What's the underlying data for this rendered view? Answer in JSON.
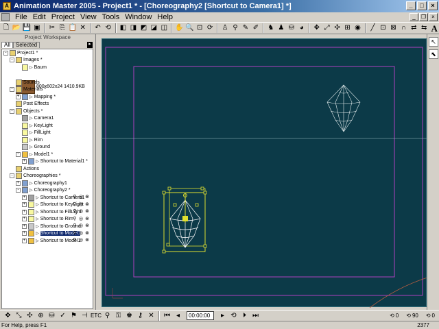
{
  "window": {
    "title": "Animation Master 2005 - Project1 * - [Choreography2 [Shortcut to Camera1] *]",
    "minimize": "_",
    "maximize": "□",
    "close": "×"
  },
  "menu": [
    "File",
    "Edit",
    "Project",
    "View",
    "Tools",
    "Window",
    "Help"
  ],
  "workspace": {
    "title": "Project Workspace",
    "tabs": [
      "All",
      "Selected"
    ],
    "tree": [
      {
        "label": "Project1 *",
        "indent": 0,
        "icon": "project-icon",
        "expand": "-"
      },
      {
        "label": "Images *",
        "indent": 1,
        "icon": "folder-icon",
        "expand": "-"
      },
      {
        "label": "Baum",
        "indent": 2,
        "icon": "image-icon",
        "expand": ""
      },
      {
        "label": "Sounds",
        "indent": 1,
        "icon": "folder-icon",
        "expand": ""
      },
      {
        "label": "Materials *",
        "indent": 1,
        "icon": "folder-icon",
        "expand": "-"
      },
      {
        "label": "Mapping *",
        "indent": 2,
        "icon": "material-icon",
        "expand": "+"
      },
      {
        "label": "Post Effects",
        "indent": 1,
        "icon": "folder-icon",
        "expand": ""
      },
      {
        "label": "Objects *",
        "indent": 1,
        "icon": "folder-icon",
        "expand": "-"
      },
      {
        "label": "Camera1",
        "indent": 2,
        "icon": "camera-icon",
        "expand": ""
      },
      {
        "label": "KeyLight",
        "indent": 2,
        "icon": "light-icon",
        "expand": ""
      },
      {
        "label": "FillLight",
        "indent": 2,
        "icon": "light-icon",
        "expand": ""
      },
      {
        "label": "Rim",
        "indent": 2,
        "icon": "light-icon",
        "expand": ""
      },
      {
        "label": "Ground",
        "indent": 2,
        "icon": "ground-icon",
        "expand": ""
      },
      {
        "label": "Model1 *",
        "indent": 2,
        "icon": "model-icon",
        "expand": "-"
      },
      {
        "label": "Shortcut to Material1 *",
        "indent": 3,
        "icon": "material-icon",
        "expand": "+"
      },
      {
        "label": "Actions",
        "indent": 1,
        "icon": "folder-icon",
        "expand": ""
      },
      {
        "label": "Choreographies *",
        "indent": 1,
        "icon": "folder-icon",
        "expand": "-"
      },
      {
        "label": "Choreography1",
        "indent": 2,
        "icon": "choreography-icon",
        "expand": "+"
      },
      {
        "label": "Choreography2 *",
        "indent": 2,
        "icon": "choreography-icon",
        "expand": "-"
      },
      {
        "label": "Shortcut to Camera1",
        "indent": 3,
        "icon": "camera-icon",
        "expand": "+"
      },
      {
        "label": "Shortcut to KeyLight",
        "indent": 3,
        "icon": "light-icon",
        "expand": "+"
      },
      {
        "label": "Shortcut to FillLight",
        "indent": 3,
        "icon": "light-icon",
        "expand": "+"
      },
      {
        "label": "Shortcut to Rim",
        "indent": 3,
        "icon": "light-icon",
        "expand": "+"
      },
      {
        "label": "Shortcut to Ground",
        "indent": 3,
        "icon": "ground-icon",
        "expand": "+"
      },
      {
        "label": "Shortcut to Model1",
        "indent": 3,
        "icon": "model-icon",
        "expand": "+",
        "selected": true
      },
      {
        "label": "Shortcut to Model1",
        "indent": 3,
        "icon": "model-icon",
        "expand": "+"
      }
    ],
    "image_info": "800x602x24 1410.9KB"
  },
  "bottom": {
    "timecode": "00:00:00",
    "etc_label": "ETC",
    "val_a": "0",
    "val_b": "90",
    "val_c": "0"
  },
  "status": {
    "help": "For Help, press F1",
    "right": "2377"
  },
  "colors": {
    "viewport_bg": "#0c3a48",
    "frame_magenta": "#b040c0",
    "selection_yellow": "#e0e030",
    "titlebar": "#0a246a"
  }
}
